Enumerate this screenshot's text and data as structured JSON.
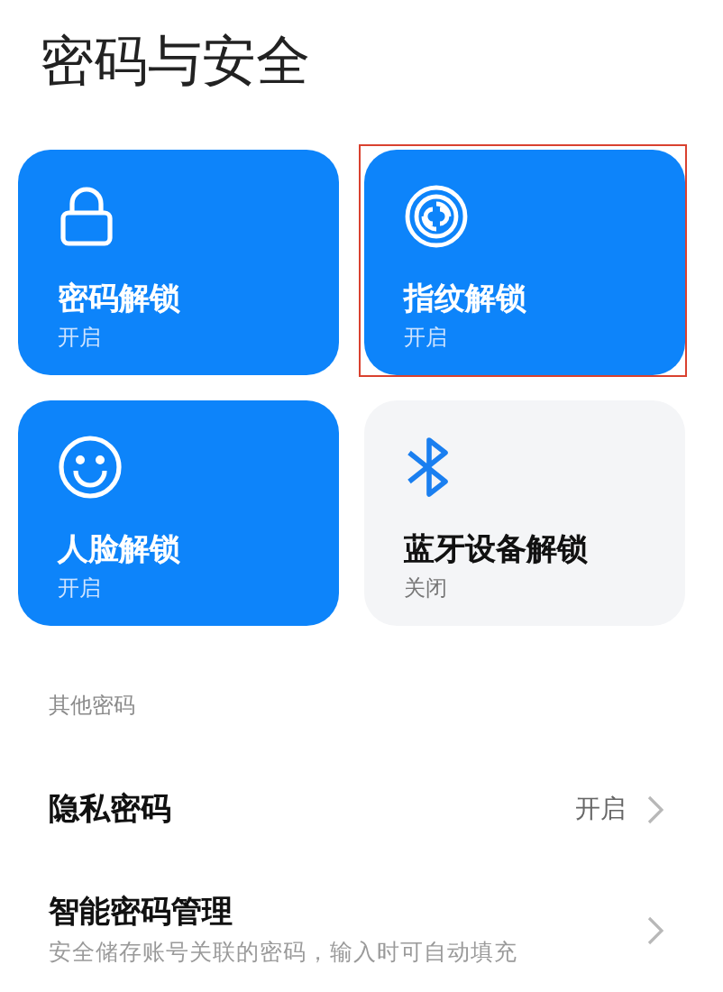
{
  "title": "密码与安全",
  "cards": [
    {
      "kind": "lock",
      "label": "密码解锁",
      "status": "开启",
      "on": true,
      "highlighted": false
    },
    {
      "kind": "fingerprint",
      "label": "指纹解锁",
      "status": "开启",
      "on": true,
      "highlighted": true
    },
    {
      "kind": "face",
      "label": "人脸解锁",
      "status": "开启",
      "on": true,
      "highlighted": false
    },
    {
      "kind": "bluetooth",
      "label": "蓝牙设备解锁",
      "status": "关闭",
      "on": false,
      "highlighted": false
    }
  ],
  "section": "其他密码",
  "rows": [
    {
      "title": "隐私密码",
      "value": "开启"
    },
    {
      "title": "智能密码管理",
      "subtitle": "安全储存账号关联的密码，输入时可自动填充"
    }
  ]
}
